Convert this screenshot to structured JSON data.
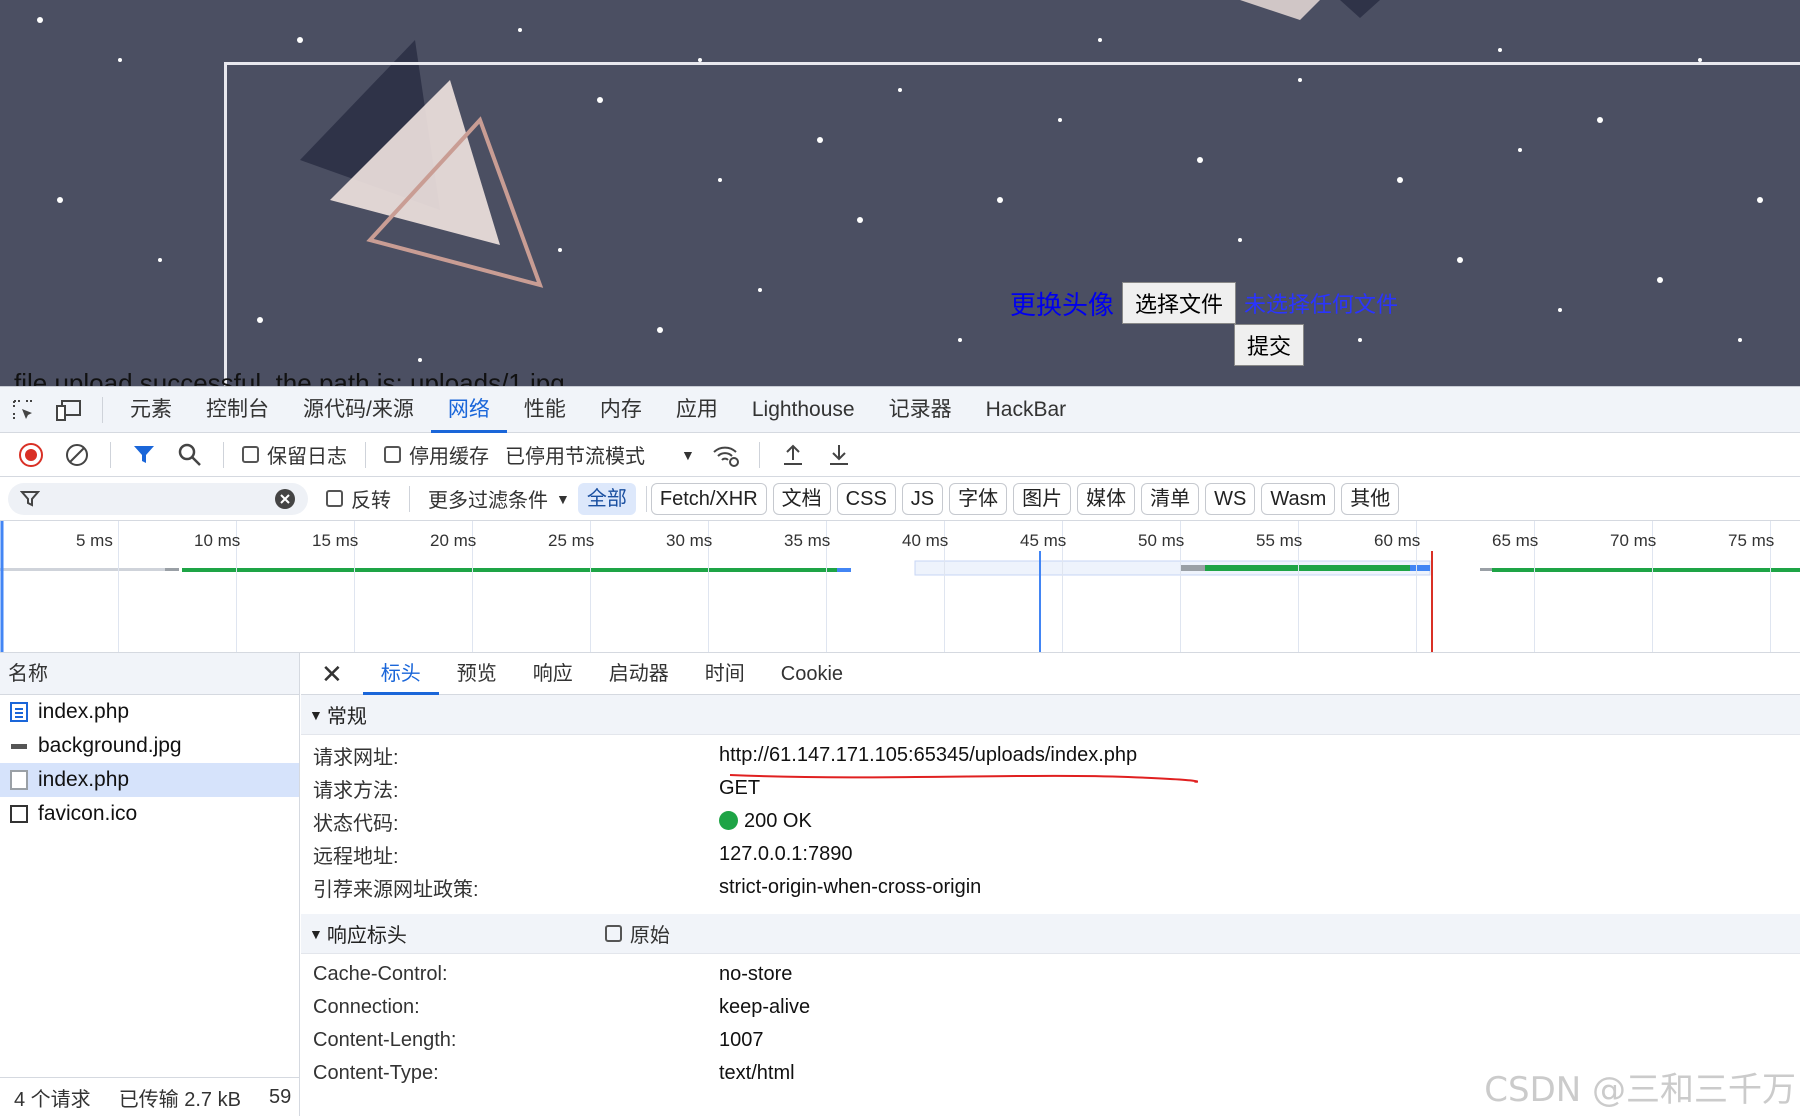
{
  "page": {
    "upload_label": "更换头像",
    "choose_file_button": "选择文件",
    "no_file_text": "未选择任何文件",
    "submit_button": "提交",
    "result_message": "file upload successful, the path is: uploads/1.jpg"
  },
  "devtools": {
    "tabs": [
      "元素",
      "控制台",
      "源代码/来源",
      "网络",
      "性能",
      "内存",
      "应用",
      "Lighthouse",
      "记录器",
      "HackBar"
    ],
    "active_tab": "网络",
    "toolbar": {
      "preserve_log": "保留日志",
      "disable_cache": "停用缓存",
      "throttling": "已停用节流模式"
    },
    "filter": {
      "invert": "反转",
      "more_filters": "更多过滤条件",
      "types": [
        "全部",
        "Fetch/XHR",
        "文档",
        "CSS",
        "JS",
        "字体",
        "图片",
        "媒体",
        "清单",
        "WS",
        "Wasm",
        "其他"
      ],
      "active_type": "全部"
    },
    "timeline": {
      "ticks": [
        "5 ms",
        "10 ms",
        "15 ms",
        "20 ms",
        "25 ms",
        "30 ms",
        "35 ms",
        "40 ms",
        "45 ms",
        "50 ms",
        "55 ms",
        "60 ms",
        "65 ms",
        "70 ms",
        "75 ms"
      ]
    },
    "requests": {
      "header": "名称",
      "items": [
        {
          "name": "index.php",
          "icon": "document-icon"
        },
        {
          "name": "background.jpg",
          "icon": "image-icon"
        },
        {
          "name": "index.php",
          "icon": "file-icon"
        },
        {
          "name": "favicon.ico",
          "icon": "blank-icon"
        }
      ],
      "selected_index": 2
    },
    "status_bar": {
      "requests": "4 个请求",
      "transferred": "已传输 2.7 kB",
      "extra": "59"
    },
    "detail": {
      "tabs": [
        "标头",
        "预览",
        "响应",
        "启动器",
        "时间",
        "Cookie"
      ],
      "active_tab": "标头",
      "general_title": "常规",
      "general": [
        {
          "key": "请求网址:",
          "value": "http://61.147.171.105:65345/uploads/index.php"
        },
        {
          "key": "请求方法:",
          "value": "GET"
        },
        {
          "key": "状态代码:",
          "value": "200 OK"
        },
        {
          "key": "远程地址:",
          "value": "127.0.0.1:7890"
        },
        {
          "key": "引荐来源网址政策:",
          "value": "strict-origin-when-cross-origin"
        }
      ],
      "response_title": "响应标头",
      "raw_label": "原始",
      "response_headers": [
        {
          "key": "Cache-Control:",
          "value": "no-store"
        },
        {
          "key": "Connection:",
          "value": "keep-alive"
        },
        {
          "key": "Content-Length:",
          "value": "1007"
        },
        {
          "key": "Content-Type:",
          "value": "text/html"
        }
      ]
    }
  },
  "watermark": "CSDN @三和三千万",
  "colors": {
    "page_bg": "#4b4f62",
    "accent": "#1a66d9",
    "status_ok": "#1ea446",
    "link": "#0000ee"
  }
}
